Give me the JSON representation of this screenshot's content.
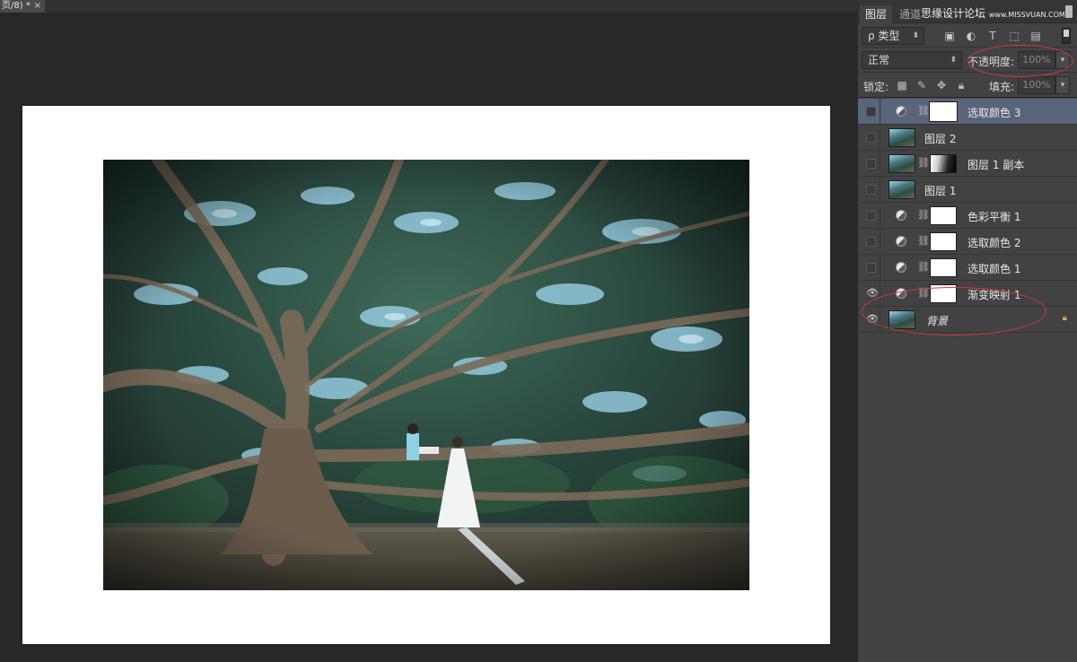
{
  "document": {
    "tab_title": "页/8) *",
    "close_glyph": "×"
  },
  "panel": {
    "tabs": [
      "图层",
      "通道"
    ],
    "watermark_main": "思缘设计论坛",
    "watermark_sub": "www.MISSVUAN.COM",
    "filter": {
      "kind_label": "ρ 类型",
      "icons": [
        "image-filter-icon",
        "adjustment-filter-icon",
        "type-filter-icon",
        "shape-filter-icon",
        "smart-object-filter-icon"
      ]
    },
    "blend": {
      "mode": "正常",
      "opacity_label": "不透明度:",
      "opacity_value": "100%"
    },
    "lock": {
      "label": "锁定:",
      "fill_label": "填充:",
      "fill_value": "100%"
    },
    "layers": [
      {
        "name": "选取颜色 3",
        "visible": false,
        "selected": true,
        "kind": "adjustment"
      },
      {
        "name": "图层 2",
        "visible": false,
        "selected": false,
        "kind": "pixel"
      },
      {
        "name": "图层 1 副本",
        "visible": false,
        "selected": false,
        "kind": "pixel-mask"
      },
      {
        "name": "图层 1",
        "visible": false,
        "selected": false,
        "kind": "pixel"
      },
      {
        "name": "色彩平衡 1",
        "visible": false,
        "selected": false,
        "kind": "adjustment"
      },
      {
        "name": "选取颜色 2",
        "visible": false,
        "selected": false,
        "kind": "adjustment"
      },
      {
        "name": "选取颜色 1",
        "visible": false,
        "selected": false,
        "kind": "adjustment"
      },
      {
        "name": "渐变映射 1",
        "visible": true,
        "selected": false,
        "kind": "adjustment"
      },
      {
        "name": "背景",
        "visible": true,
        "selected": false,
        "kind": "background",
        "locked": true
      }
    ]
  },
  "colors": {
    "annotation": "#d23b3b",
    "selected_layer": "#59657a",
    "panel_bg": "#424242",
    "workspace_bg": "#282828"
  }
}
